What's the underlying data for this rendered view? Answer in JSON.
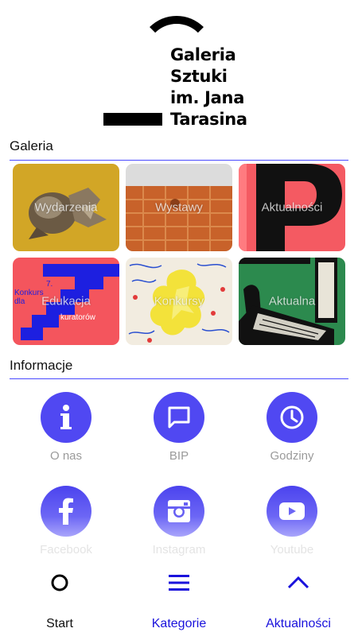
{
  "logo": {
    "lines": [
      "Galeria",
      "Sztuki",
      "im. Jana",
      "Tarasina"
    ]
  },
  "sections": {
    "gallery": "Galeria",
    "info": "Informacje"
  },
  "gallery_tiles": [
    {
      "label": "Wydarzenia"
    },
    {
      "label": "Wystawy"
    },
    {
      "label": "Aktualności"
    },
    {
      "label": "Edukacja",
      "poster_text": [
        "7.",
        "Konkurs",
        "dla",
        "kuratorów"
      ]
    },
    {
      "label": "Konkursy"
    },
    {
      "label": "Aktualna"
    }
  ],
  "info_items": [
    {
      "label": "O nas",
      "icon": "info-icon"
    },
    {
      "label": "BIP",
      "icon": "chat-icon"
    },
    {
      "label": "Godziny",
      "icon": "clock-icon"
    },
    {
      "label": "Facebook",
      "icon": "facebook-icon"
    },
    {
      "label": "Instagram",
      "icon": "instagram-icon"
    },
    {
      "label": "Youtube",
      "icon": "youtube-icon"
    }
  ],
  "nav": {
    "start": "Start",
    "categories": "Kategorie",
    "news": "Aktualności"
  },
  "colors": {
    "accent": "#5048f2",
    "divider": "#4a4aff",
    "nav_active": "#1a12dc"
  }
}
